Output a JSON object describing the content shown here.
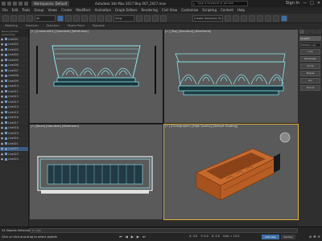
{
  "titlebar": {
    "workspace": "Workspaces: Default",
    "title": "Autodesk 3ds Max 2017   Bep 007_2017.max",
    "search_placeholder": "Type a keyword or phrase",
    "user": "Sign In",
    "win_min": "—",
    "win_max": "□",
    "win_close": "✕"
  },
  "menu": [
    "File",
    "Edit",
    "Tools",
    "Group",
    "Views",
    "Create",
    "Modifiers",
    "Animation",
    "Graph Editors",
    "Rendering",
    "Civil View",
    "Customize",
    "Scripting",
    "Content",
    "Help"
  ],
  "toolbar": {
    "selection_filter": "All",
    "view_dropdown": "View",
    "create_selection_set": "Create Selection Se"
  },
  "ribbon": [
    "Modeling",
    "Freeform",
    "Selection",
    "Object Paint",
    "Populate"
  ],
  "scene_explorer": {
    "header": "Name (Sorted Ascending)",
    "items": [
      "Line001",
      "Line002",
      "Line003",
      "Line004",
      "Line005",
      "Line006",
      "Line007",
      "Line008",
      "Line009",
      "Line010",
      "Line011",
      "Line012",
      "Line013",
      "Line014",
      "Line015",
      "Line016",
      "Line017",
      "Line018",
      "Line019",
      "Line020",
      "Line021",
      "Line022",
      "Line023",
      "Line024"
    ],
    "selected_index": 21
  },
  "viewports": {
    "tl": "[+] [Camera001] [Standard] [Wireframe]",
    "tr": "[+] [Top] [Standard] [Wireframe]",
    "bl": "[+] [Back] [Standard] [Wireframe]",
    "br": "[+] [Orthographic] [High Quality] [Default Shading]"
  },
  "command_panel": {
    "object_name": "Line001",
    "modifier_list": "Modifier List",
    "buttons": [
      "Line",
      "Rectangle",
      "Circle",
      "Ellipse",
      "Arc",
      "Donut"
    ]
  },
  "status": {
    "timeline": "0 / 100",
    "line1": "24 Objects Selected",
    "line2": "Click or click-and-drag to select objects",
    "x": "X: 0.0",
    "y": "Y: 0.0",
    "z": "Z: 0.0",
    "grid": "Grid = 10.0",
    "autokey": "Auto Key",
    "setkey": "Set Key",
    "colors": {
      "wire": "#8fe8f0",
      "wood": "#c66a2e",
      "accent": "#3d6ea8"
    }
  }
}
